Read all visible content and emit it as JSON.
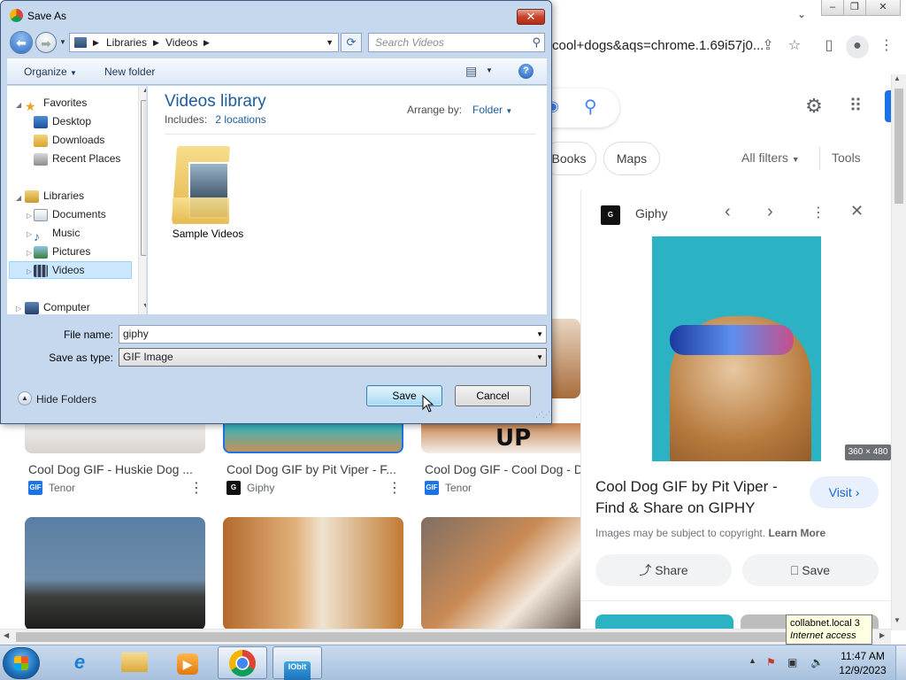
{
  "browser": {
    "omnibox_text": "cool+dogs&aqs=chrome.1.69i57j0...",
    "chips": [
      "Books",
      "Maps"
    ],
    "all_filters": "All filters",
    "tools": "Tools",
    "thumbs": [
      {
        "title": "Cool Dog GIF - Huskie Dog ...",
        "source": "Tenor"
      },
      {
        "title": "Cool Dog GIF by Pit Viper - F...",
        "source": "Giphy"
      },
      {
        "title": "Cool Dog GIF - Cool Dog - D",
        "source": "Tenor"
      }
    ],
    "panel": {
      "source": "Giphy",
      "dims": "360 × 480",
      "title": "Cool Dog GIF by Pit Viper - Find & Share on GIPHY",
      "visit": "Visit",
      "copyright": "Images may be subject to copyright.",
      "learn_more": "Learn More",
      "share": "Share",
      "save": "Save"
    },
    "tooltip_line1": "collabnet.local",
    "tooltip_num": "3",
    "tooltip_line2": "Internet access"
  },
  "dialog": {
    "title": "Save As",
    "breadcrumb": [
      "Libraries",
      "Videos"
    ],
    "search_placeholder": "Search Videos",
    "organize": "Organize",
    "new_folder": "New folder",
    "nav": {
      "favorites": "Favorites",
      "desktop": "Desktop",
      "downloads": "Downloads",
      "recent": "Recent Places",
      "libraries": "Libraries",
      "documents": "Documents",
      "music": "Music",
      "pictures": "Pictures",
      "videos": "Videos",
      "computer": "Computer"
    },
    "library_title": "Videos library",
    "includes_label": "Includes:",
    "includes_link": "2 locations",
    "arrange_label": "Arrange by:",
    "arrange_value": "Folder",
    "folder_name": "Sample Videos",
    "file_name_label": "File name:",
    "file_name_value": "giphy",
    "save_type_label": "Save as type:",
    "save_type_value": "GIF Image",
    "hide_folders": "Hide Folders",
    "save": "Save",
    "cancel": "Cancel"
  },
  "taskbar": {
    "time": "11:47 AM",
    "date": "12/9/2023"
  }
}
